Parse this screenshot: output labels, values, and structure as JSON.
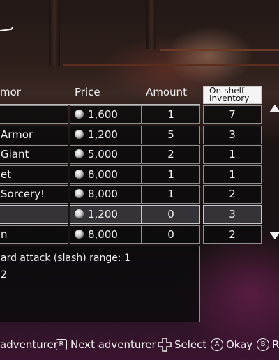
{
  "header": {
    "item_col_partial": "mor",
    "price_col": "Price",
    "amount_col": "Amount",
    "inventory_col_line1": "On-shelf",
    "inventory_col_line2": "Inventory"
  },
  "items": [
    {
      "name": "",
      "price": "1,600",
      "amount": "1",
      "inventory": "7",
      "selected": false
    },
    {
      "name": "Armor",
      "price": "1,200",
      "amount": "5",
      "inventory": "3",
      "selected": false
    },
    {
      "name": "Giant",
      "price": "5,000",
      "amount": "2",
      "inventory": "1",
      "selected": false
    },
    {
      "name": "et",
      "price": "8,000",
      "amount": "1",
      "inventory": "1",
      "selected": false
    },
    {
      "name": "Sorcery!",
      "price": "8,000",
      "amount": "1",
      "inventory": "2",
      "selected": false
    },
    {
      "name": "",
      "price": "1,200",
      "amount": "0",
      "inventory": "3",
      "selected": true
    },
    {
      "name": "n",
      "price": "8,000",
      "amount": "0",
      "inventory": "2",
      "selected": false
    }
  ],
  "description": {
    "line1": "ard attack (slash) range: 1",
    "line2": "2"
  },
  "footer": {
    "prev_label": "adventurer",
    "r_button": "R",
    "next_label": "Next adventurer",
    "select_label": "Select",
    "a_button": "A",
    "okay_label": "Okay",
    "b_button": "B",
    "b_label_partial": "R"
  },
  "icons": {
    "currency": "coin-icon",
    "scroll_up": "arrow-up-icon",
    "scroll_down": "arrow-down-icon",
    "dpad": "dpad-icon"
  }
}
